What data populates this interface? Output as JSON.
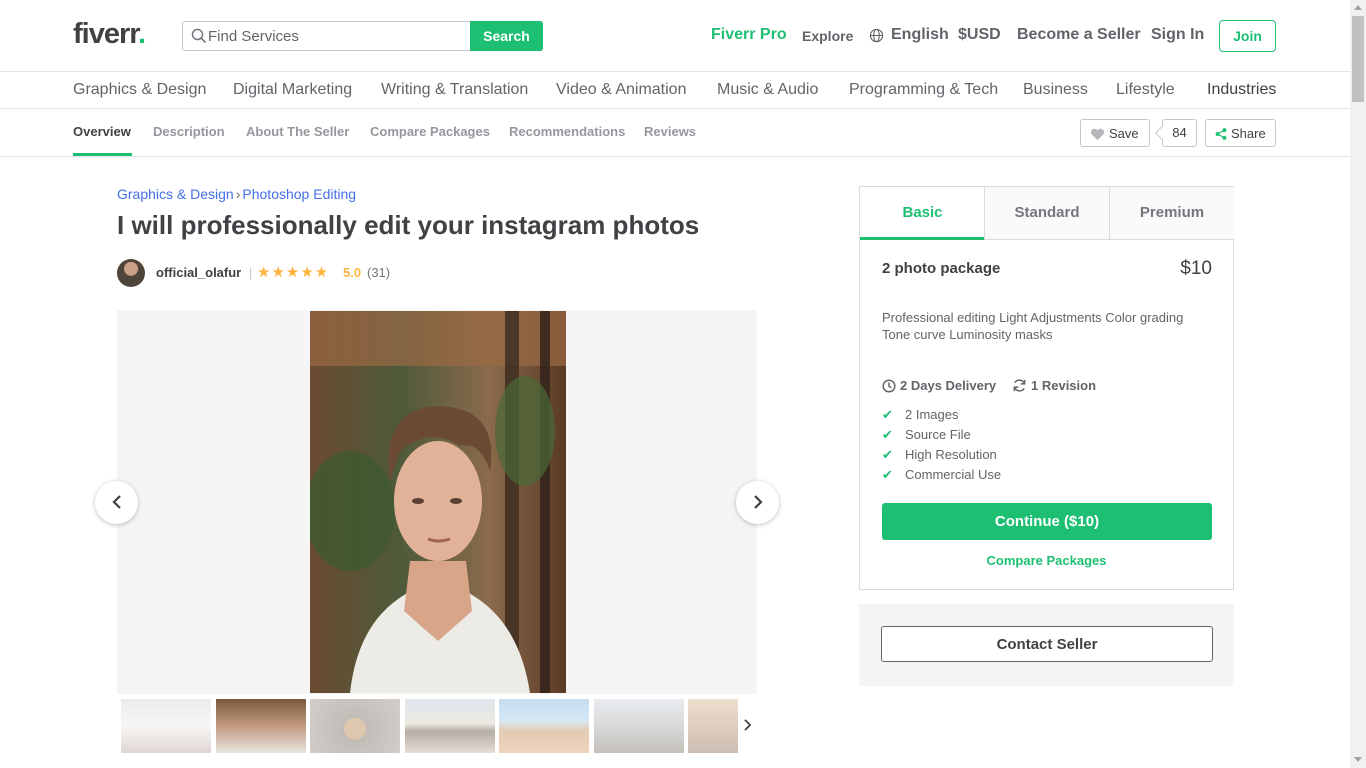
{
  "header": {
    "logo_text": "fiverr",
    "logo_dot": ".",
    "search_placeholder": "Find Services",
    "search_button": "Search",
    "nav": {
      "pro": "Fiverr Pro",
      "explore": "Explore",
      "language": "English",
      "currency": "$USD",
      "become_seller": "Become a Seller",
      "sign_in": "Sign In",
      "join": "Join"
    }
  },
  "categories": [
    "Graphics & Design",
    "Digital Marketing",
    "Writing & Translation",
    "Video & Animation",
    "Music & Audio",
    "Programming & Tech",
    "Business",
    "Lifestyle",
    "Industries"
  ],
  "subnav": {
    "tabs": [
      "Overview",
      "Description",
      "About The Seller",
      "Compare Packages",
      "Recommendations",
      "Reviews"
    ],
    "save_label": "Save",
    "save_count": "84",
    "share_label": "Share"
  },
  "gig": {
    "breadcrumb": [
      "Graphics & Design",
      "Photoshop Editing"
    ],
    "breadcrumb_sep": "›",
    "title": "I will professionally edit your instagram photos",
    "seller_name": "official_olafur",
    "stars": "★★★★★",
    "rating": "5.0",
    "rating_count": "(31)",
    "active_thumbnail": 2,
    "thumbnail_count": 7
  },
  "package": {
    "tabs": [
      "Basic",
      "Standard",
      "Premium"
    ],
    "active_tab": "Basic",
    "name": "2 photo package",
    "price": "$10",
    "description": "Professional editing Light Adjustments Color grading Tone curve Luminosity masks",
    "delivery": "2 Days Delivery",
    "revisions": "1 Revision",
    "features": [
      "2 Images",
      "Source File",
      "High Resolution",
      "Commercial Use"
    ],
    "continue_label": "Continue ($10)",
    "compare_label": "Compare Packages",
    "contact_label": "Contact Seller"
  },
  "colors": {
    "brand_green": "#1dbf73",
    "link_blue": "#446ee7",
    "star_gold": "#ffb33e",
    "text_dark": "#404145"
  }
}
